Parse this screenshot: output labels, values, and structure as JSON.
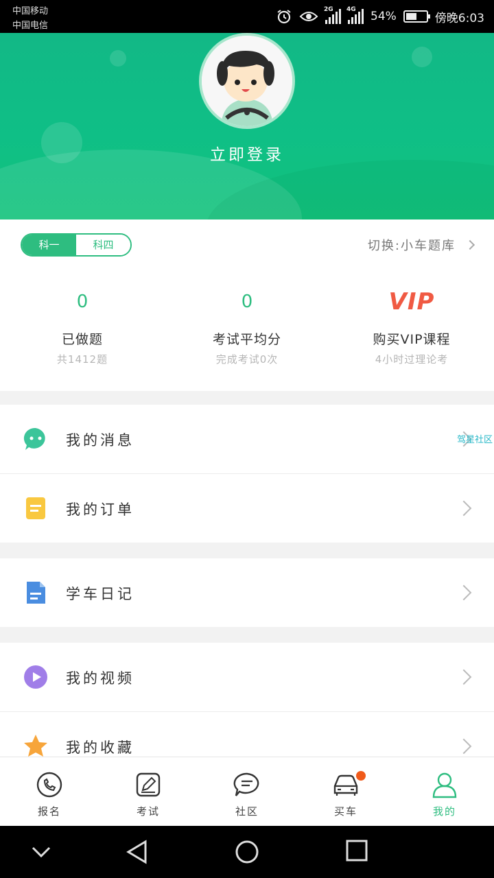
{
  "status_bar": {
    "carrier1": "中国移动",
    "carrier2": "中国电信",
    "net1": "2G",
    "net2": "4G",
    "battery": "54%",
    "battery_level": 0.54,
    "time": "傍晚6:03"
  },
  "profile": {
    "login_text": "立即登录"
  },
  "subjects": {
    "tab1": "科一",
    "tab2": "科四",
    "active": "科一"
  },
  "switch_bank": "切换:小车题库",
  "stats": [
    {
      "value": "0",
      "label": "已做题",
      "sub": "共1412题"
    },
    {
      "value": "0",
      "label": "考试平均分",
      "sub": "完成考试0次"
    },
    {
      "value": "VIP",
      "label": "购买VIP课程",
      "sub": "4小时过理论考"
    }
  ],
  "menu": {
    "messages": "我的消息",
    "messages_tag": "驾星社区",
    "orders": "我的订单",
    "diary": "学车日记",
    "videos": "我的视频",
    "favorites": "我的收藏"
  },
  "tabs": [
    "报名",
    "考试",
    "社区",
    "买车",
    "我的"
  ],
  "colors": {
    "accent": "#2ebd80",
    "header": "#12b886",
    "vip": "#f05a43"
  }
}
